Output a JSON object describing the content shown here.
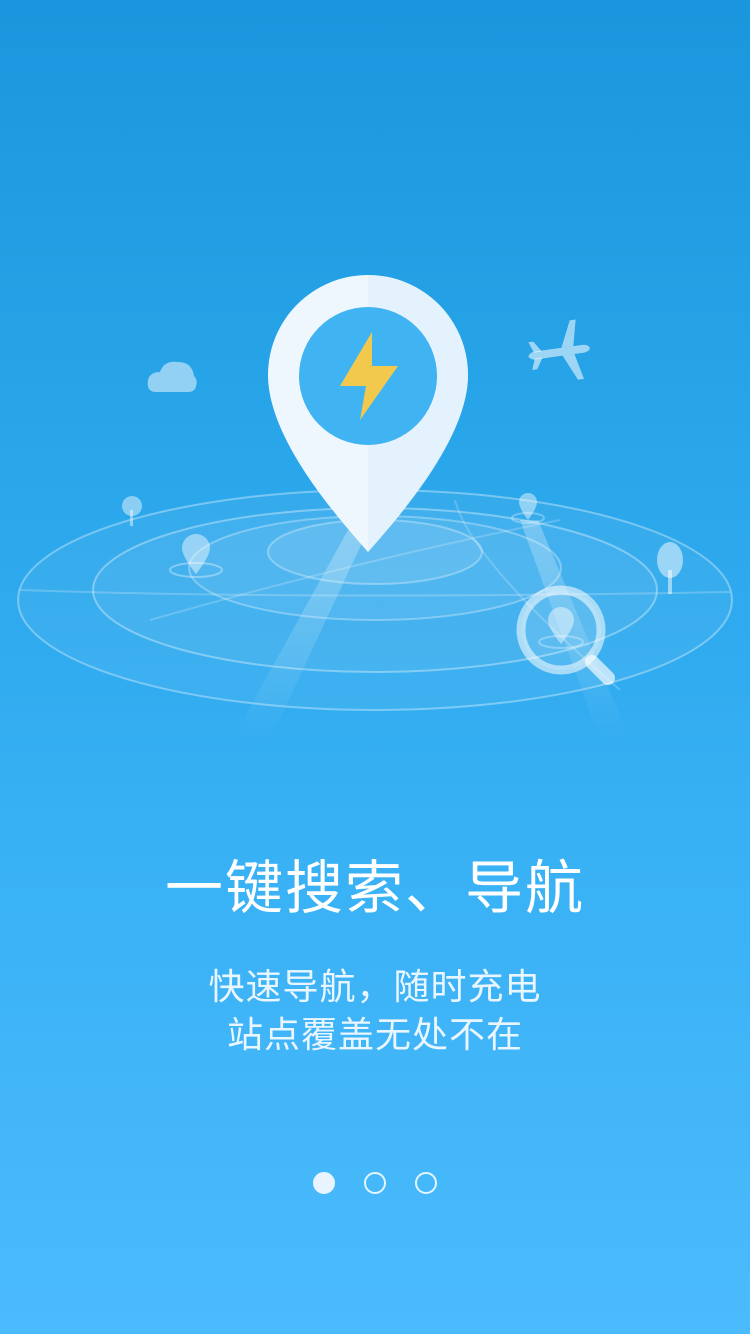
{
  "onboarding": {
    "page_index": 1,
    "page_count": 3,
    "headline": "一键搜索、导航",
    "subtitle_lines": [
      "快速导航，随时充电",
      "站点覆盖无处不在"
    ]
  },
  "illustration": {
    "icons": [
      "location-pin-icon",
      "lightning-bolt-icon",
      "cloud-icon",
      "airplane-icon",
      "tree-icon",
      "magnifier-icon"
    ]
  },
  "colors": {
    "background_top": "#1a96de",
    "background_bottom": "#4bbbfd",
    "pin_body": "#eef7fe",
    "pin_center": "#40b4f2",
    "bolt": "#f2c94c",
    "text": "#ffffff"
  }
}
